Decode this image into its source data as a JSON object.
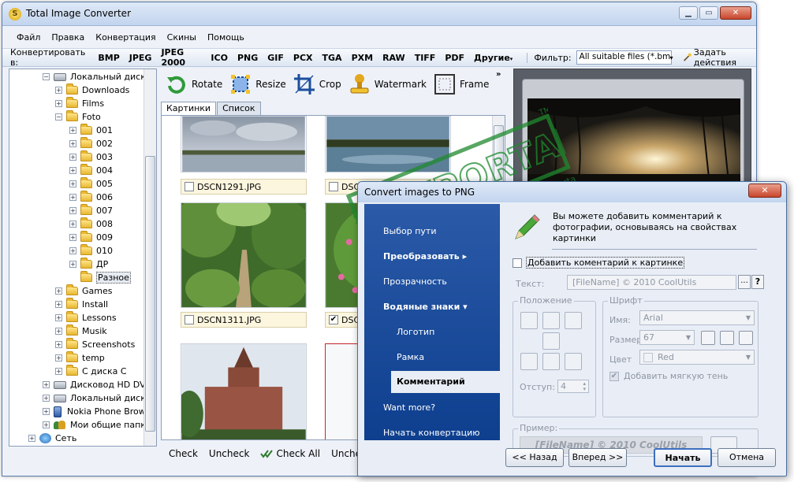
{
  "window": {
    "title": "Total Image Converter",
    "app_icon": "app-logo-icon"
  },
  "menu": [
    "Файл",
    "Правка",
    "Конвертация",
    "Скины",
    "Помощь"
  ],
  "formatbar": {
    "convert_label": "Конвертировать в:",
    "formats": [
      "BMP",
      "JPEG",
      "JPEG 2000",
      "ICO",
      "PNG",
      "GIF",
      "PCX",
      "TGA",
      "PXM",
      "RAW",
      "TIFF",
      "PDF"
    ],
    "more_label": "Другие",
    "filter_label": "Фильтр:",
    "filter_value": "All suitable files (*.bmp,*.j",
    "task_label": "Задать действия"
  },
  "tree": {
    "root": "Локальный диск (E",
    "items": [
      "Downloads",
      "Films",
      "Foto",
      "001",
      "002",
      "003",
      "004",
      "005",
      "006",
      "007",
      "008",
      "009",
      "010",
      "ДР",
      "Разное",
      "Games",
      "Install",
      "Lessons",
      "Musik",
      "Screenshots",
      "temp",
      "С диска С"
    ],
    "dvd": "Дисковод HD DVD-",
    "drive2": "Локальный диск (H",
    "phone": "Nokia Phone Browse",
    "shared": "Мои общие папки",
    "network": "Сеть"
  },
  "actions": {
    "rotate": "Rotate",
    "resize": "Resize",
    "crop": "Crop",
    "watermark": "Watermark",
    "frame": "Frame",
    "more": "»"
  },
  "tabs": {
    "pictures": "Картинки",
    "list": "Список"
  },
  "thumbs": [
    {
      "name": "DSCN1291.JPG",
      "checked": false
    },
    {
      "name": "DSCN",
      "checked": false
    },
    {
      "name": "DSCN1311.JPG",
      "checked": false
    },
    {
      "name": "DSCN",
      "checked": true
    }
  ],
  "bottombar": {
    "check": "Check",
    "uncheck": "Uncheck",
    "check_all": "Check All",
    "uncheck_all": "Uncheck a"
  },
  "dialog": {
    "title": "Convert images to PNG",
    "close": "✕",
    "nav": {
      "path": "Выбор пути",
      "convert": "Преобразовать",
      "transparency": "Прозрачность",
      "watermarks": "Водяные знаки",
      "logo": "Логотип",
      "frame": "Рамка",
      "comment": "Комментарий",
      "want_more": "Want more?",
      "start": "Начать конвертацию"
    },
    "intro": "Вы можете добавить комментарий к фотографии, основываясь на свойствах картинки",
    "add_comment_label": "Добавить коментарий к картинке",
    "add_comment_checked": false,
    "text_label": "Текст:",
    "text_value": "[FileName] © 2010 CoolUtils",
    "dots": "...",
    "help": "?",
    "position_title": "Положение",
    "offset_label": "Отступ:",
    "offset_value": "4",
    "font_title": "Шрифт",
    "name_label": "Имя:",
    "name_value": "Arial",
    "size_label": "Размер:",
    "size_value": "67",
    "color_label": "Цвет",
    "color_value": "Red",
    "shadow_label": "Добавить мягкую тень",
    "shadow_checked": true,
    "example_title": "Пример:",
    "example_text": "[FileName] © 2010 CoolUtils",
    "back": "<< Назад",
    "next": "Вперед >>",
    "start_btn": "Начать",
    "cancel": "Отмена"
  },
  "watermark": {
    "brand": "SOFTPORTAL",
    "url": "www.softportal.com",
    "tm": "TM"
  },
  "colors": {
    "sidebar_blue": "#0e3f8e",
    "accent": "#3c6fbf",
    "watermark_green": "#1f8a2e"
  }
}
